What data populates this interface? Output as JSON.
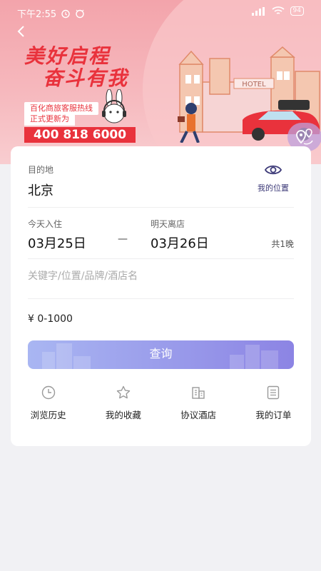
{
  "status_bar": {
    "time": "下午2:55",
    "battery": "94"
  },
  "banner": {
    "slogan_line1": "美好启程",
    "slogan_line2": "奋斗有我",
    "hotline_tag1": "百化商旅客服热线",
    "hotline_tag2": "正式更新为",
    "hotline_number": "400 818 6000",
    "sign_text": "HOTEL"
  },
  "form": {
    "destination_label": "目的地",
    "destination_value": "北京",
    "my_location_label": "我的位置",
    "checkin_label": "今天入住",
    "checkin_date": "03月25日",
    "separator": "—",
    "checkout_label": "明天离店",
    "checkout_date": "03月26日",
    "nights": "共1晚",
    "keyword_placeholder": "关键字/位置/品牌/酒店名",
    "keyword_value": "",
    "price_range": "¥ 0-1000",
    "search_button": "查询"
  },
  "shortcuts": [
    {
      "label": "浏览历史",
      "icon": "clock-icon"
    },
    {
      "label": "我的收藏",
      "icon": "star-icon"
    },
    {
      "label": "协议酒店",
      "icon": "building-icon"
    },
    {
      "label": "我的订单",
      "icon": "list-icon"
    }
  ],
  "colors": {
    "accent_red": "#e9323c",
    "button_start": "#a9b6f2",
    "button_end": "#8c84e4",
    "location_text": "#3d3a78"
  }
}
